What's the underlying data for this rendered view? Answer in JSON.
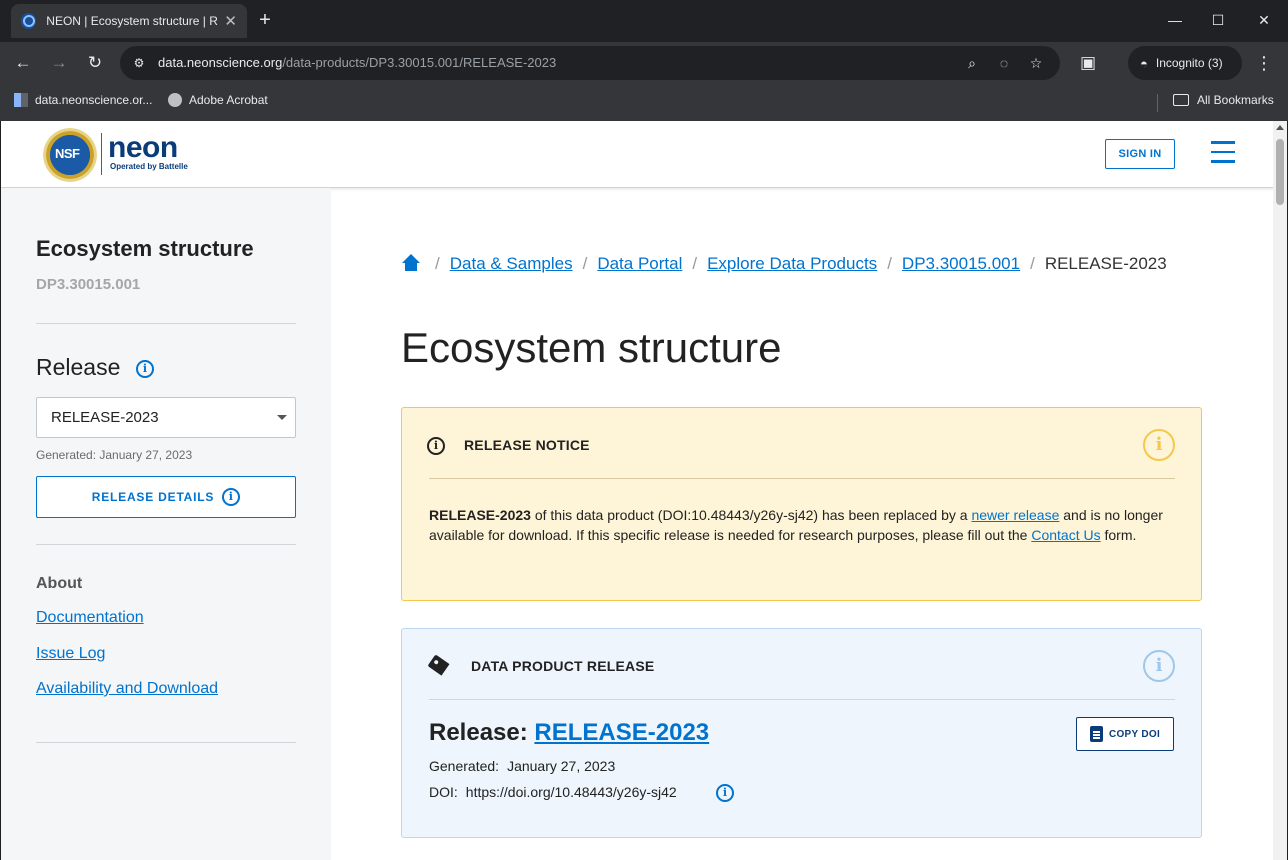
{
  "browser": {
    "tab_title": "NEON | Ecosystem structure | Re",
    "url_host": "data.neonscience.org",
    "url_path": "/data-products/DP3.30015.001/RELEASE-2023",
    "incognito_label": "Incognito (3)",
    "bookmarks": [
      {
        "label": "data.neonscience.or...",
        "icon": "grid-icon"
      },
      {
        "label": "Adobe Acrobat",
        "icon": "globe-icon"
      }
    ],
    "all_bookmarks_label": "All Bookmarks"
  },
  "header": {
    "nsf_text": "NSF",
    "logo_word": "neon",
    "logo_sub": "Operated by Battelle",
    "sign_in_label": "SIGN IN"
  },
  "sidebar": {
    "title": "Ecosystem structure",
    "product_code": "DP3.30015.001",
    "release_heading": "Release",
    "release_selected": "RELEASE-2023",
    "generated": "Generated: January 27, 2023",
    "release_details_label": "RELEASE DETAILS",
    "about_heading": "About",
    "links": [
      "Documentation",
      "Issue Log",
      "Availability and Download"
    ]
  },
  "breadcrumb": {
    "items": [
      "Data & Samples",
      "Data Portal",
      "Explore Data Products",
      "DP3.30015.001"
    ],
    "current": "RELEASE-2023"
  },
  "main": {
    "title": "Ecosystem structure"
  },
  "notice": {
    "heading": "RELEASE NOTICE",
    "release_bold": "RELEASE-2023",
    "text_1": " of this data product (DOI:10.48443/y26y-sj42) has been replaced by a ",
    "newer_release_link": "newer release",
    "text_2": " and is no longer available for download. If this specific release is needed for research purposes, please fill out the ",
    "contact_link": "Contact Us",
    "text_3": " form."
  },
  "release_card": {
    "heading": "DATA PRODUCT RELEASE",
    "release_label": "Release: ",
    "release_link": "RELEASE-2023",
    "copy_doi_label": "COPY DOI",
    "generated_label": "Generated:",
    "generated_value": "January 27, 2023",
    "doi_label": "DOI:",
    "doi_value": "https://doi.org/10.48443/y26y-sj42"
  },
  "colors": {
    "accent": "#0073cf",
    "notice_bg": "#fef4d7",
    "notice_border": "#f2c94c",
    "release_bg": "#eef5fc"
  }
}
